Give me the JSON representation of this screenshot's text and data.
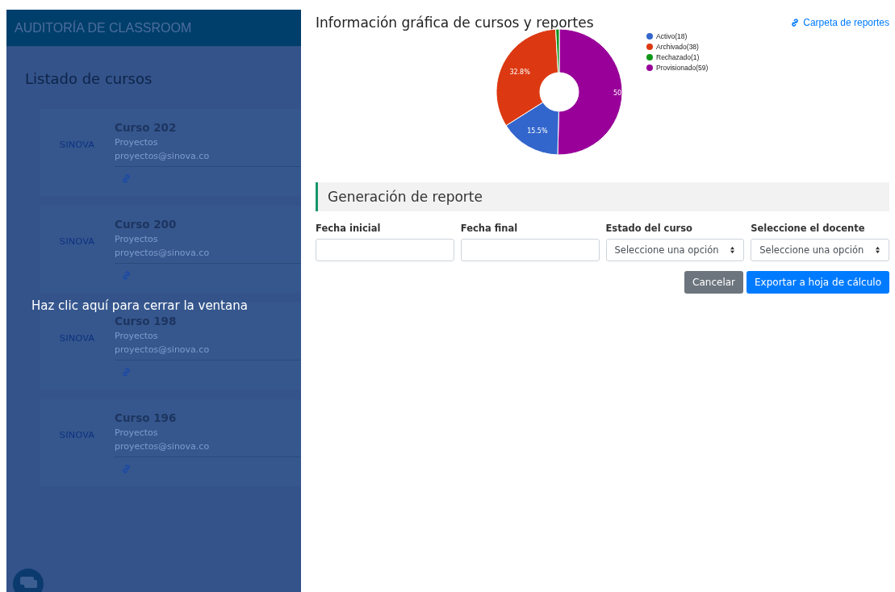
{
  "sidebar": {
    "title": "AUDITORÍA DE CLASSROOM",
    "heading": "Listado de cursos",
    "overlay_message": "Haz clic aquí para cerrar la ventana",
    "courses": [
      {
        "name": "Curso 202",
        "logo": "SINOVA",
        "department": "Proyectos",
        "email": "proyectos@sinova.co"
      },
      {
        "name": "Curso 200",
        "logo": "SINOVA",
        "department": "Proyectos",
        "email": "proyectos@sinova.co"
      },
      {
        "name": "Curso 198",
        "logo": "SINOVA",
        "department": "Proyectos",
        "email": "proyectos@sinova.co"
      },
      {
        "name": "Curso 196",
        "logo": "SINOVA",
        "department": "Proyectos",
        "email": "proyectos@sinova.co"
      }
    ]
  },
  "chart_section": {
    "title": "Información gráfica de cursos y reportes",
    "link": "Carpeta de reportes",
    "chart_data": {
      "type": "donut",
      "categories": [
        "Activo(18)",
        "Archivado(38)",
        "Rechazado(1)",
        "Provisionado(59)"
      ],
      "values": [
        15.5,
        32.8,
        0.9,
        50
      ],
      "legend": true,
      "colors": [
        "#3366cc",
        "#dc3912",
        "#109618",
        "#990099"
      ],
      "value_labels": [
        "15.5%",
        "32.8%",
        null,
        "50"
      ]
    }
  },
  "report": {
    "title": "Generación de reporte",
    "fields": [
      {
        "label": "Fecha inicial",
        "kind": "date"
      },
      {
        "label": "Fecha final",
        "kind": "date"
      },
      {
        "label": "Estado del curso",
        "kind": "select",
        "value": "Seleccione una opción"
      },
      {
        "label": "Seleccione el docente",
        "kind": "select",
        "value": "Seleccione una opción"
      }
    ],
    "buttons": [
      {
        "label": "Cancelar",
        "kind": "secondary"
      },
      {
        "label": "Exportar a hoja de cálculo",
        "kind": "primary"
      }
    ]
  }
}
